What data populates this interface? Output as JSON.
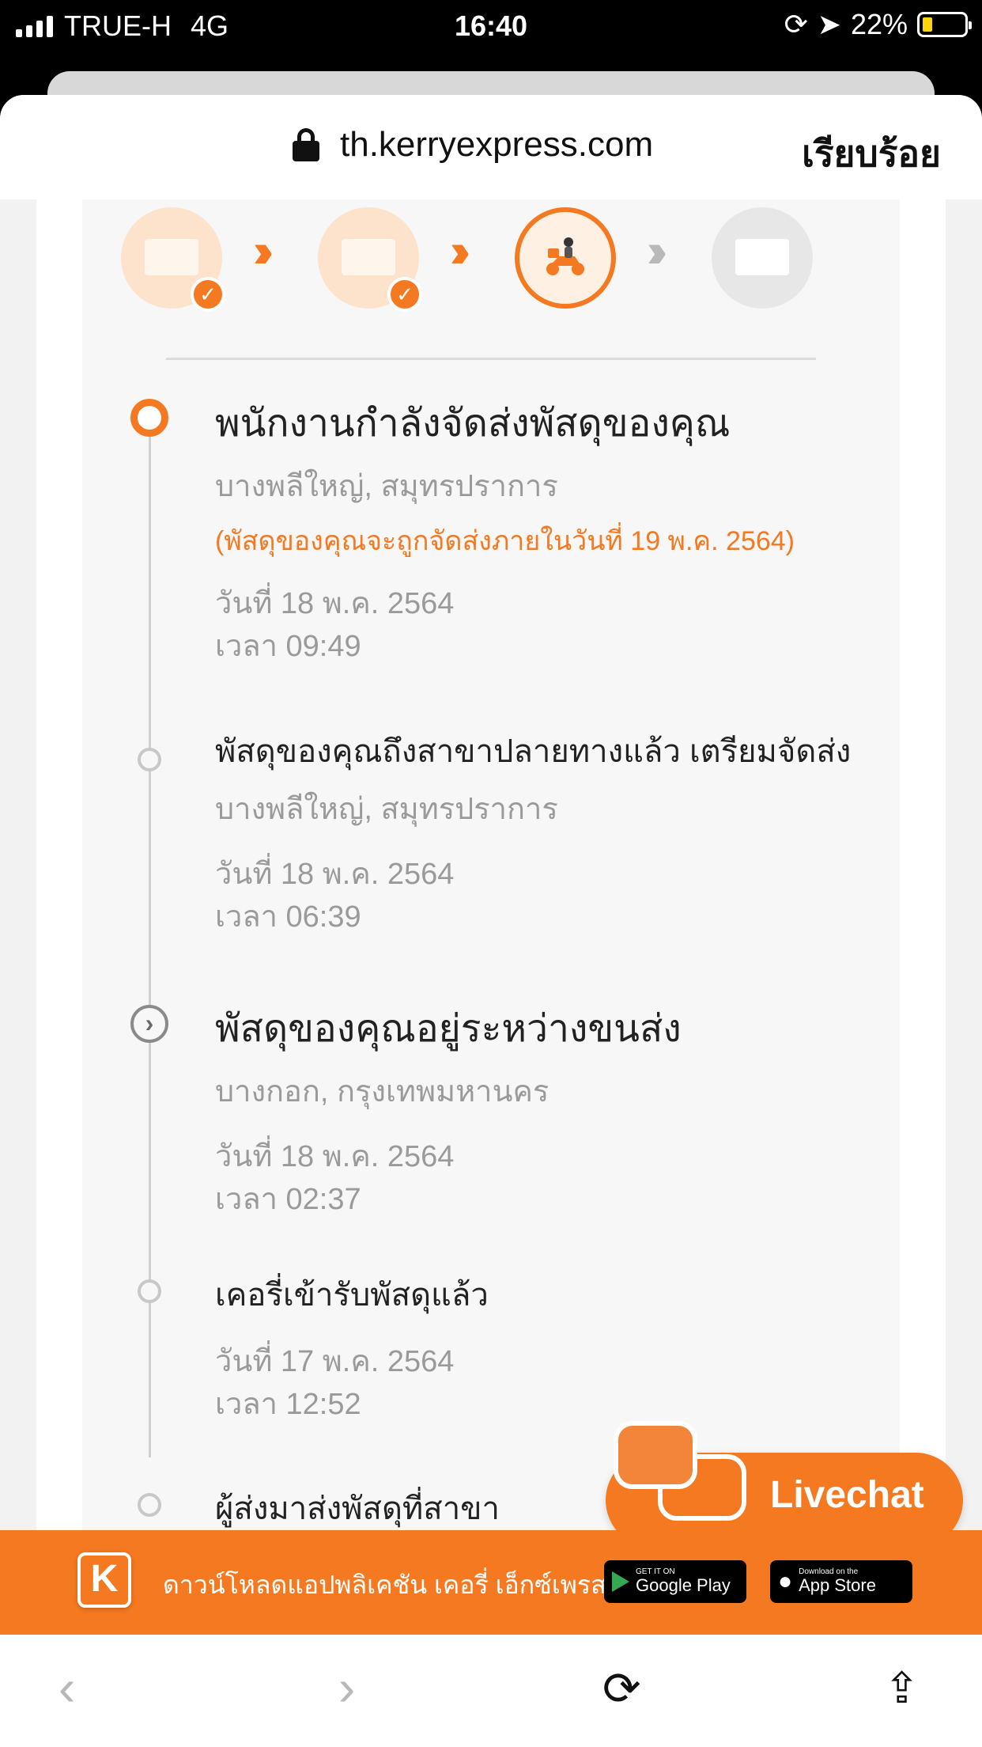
{
  "status_bar": {
    "carrier": "TRUE-H",
    "network": "4G",
    "time": "16:40",
    "battery": "22%"
  },
  "browser": {
    "url": "th.kerryexpress.com",
    "done_label": "เรียบร้อย"
  },
  "progress": {
    "steps": [
      {
        "name": "received",
        "state": "done"
      },
      {
        "name": "in-transit",
        "state": "done"
      },
      {
        "name": "out-for-delivery",
        "state": "current"
      },
      {
        "name": "delivered",
        "state": "pending"
      }
    ]
  },
  "timeline": [
    {
      "title": "พนักงานกำลังจัดส่งพัสดุของคุณ",
      "location": "บางพลีใหญ่, สมุทรปราการ",
      "note": "(พัสดุของคุณจะถูกจัดส่งภายในวันที่ 19 พ.ค. 2564)",
      "date": "วันที่ 18 พ.ค. 2564",
      "time": "เวลา 09:49"
    },
    {
      "title": "พัสดุของคุณถึงสาขาปลายทางแล้ว เตรียมจัดส่ง",
      "location": "บางพลีใหญ่, สมุทรปราการ",
      "date": "วันที่ 18 พ.ค. 2564",
      "time": "เวลา 06:39"
    },
    {
      "title": "พัสดุของคุณอยู่ระหว่างขนส่ง",
      "location": "บางกอก, กรุงเทพมหานคร",
      "date": "วันที่ 18 พ.ค. 2564",
      "time": "เวลา 02:37"
    },
    {
      "title": "เคอรี่เข้ารับพัสดุแล้ว",
      "date": "วันที่ 17 พ.ค. 2564",
      "time": "เวลา 12:52"
    },
    {
      "title": "ผู้ส่งมาส่งพัสดุที่สาขา"
    }
  ],
  "livechat": {
    "label": "Livechat"
  },
  "app_banner": {
    "text": "ดาวน์โหลดแอปพลิเคชัน เคอรี่ เอ็กซ์เพรส",
    "google_small": "GET IT ON",
    "google_big": "Google Play",
    "apple_small": "Download on the",
    "apple_big": "App Store"
  },
  "colors": {
    "accent": "#f47920",
    "muted": "#9a9a9a"
  }
}
